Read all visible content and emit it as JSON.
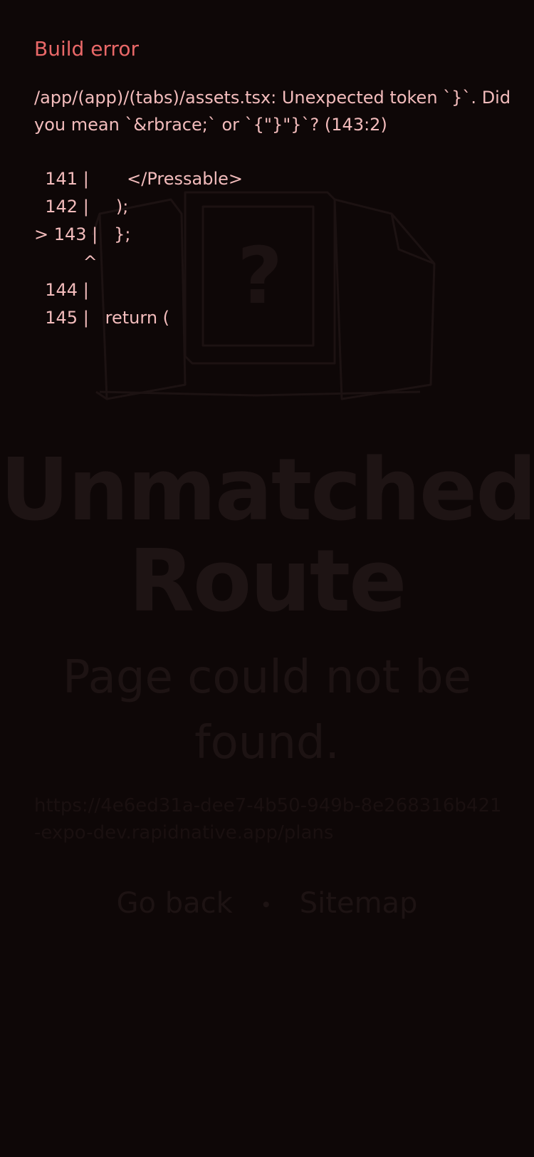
{
  "background_screen": {
    "illustration_glyph": "?",
    "title": "Unmatched\nRoute",
    "subtitle": "Page could not be found.",
    "url": "https://4e6ed31a-dee7-4b50-949b-8e268316b421-expo-dev.rapidnative.app/plans",
    "go_back_label": "Go back",
    "separator": "•",
    "sitemap_label": "Sitemap"
  },
  "error": {
    "heading": "Build error",
    "message": "/app/(app)/(tabs)/assets.tsx: Unexpected token `}`. Did you mean `&rbrace;` or `{\"}\"}`? (143:2)",
    "code_lines": [
      "  141 |       </Pressable>",
      "  142 |     );",
      "> 143 |   };",
      "         ^",
      "  144 |",
      "  145 |   return ("
    ]
  },
  "colors": {
    "background": "#0e0707",
    "heading": "#e96868",
    "message": "#f3bcbc"
  }
}
